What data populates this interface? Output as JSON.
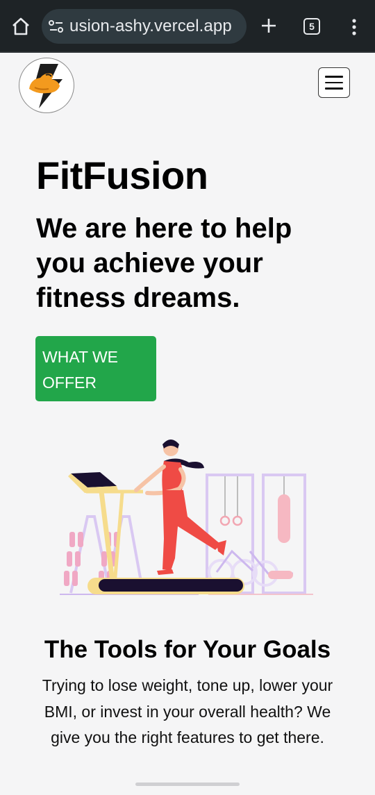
{
  "browser": {
    "url": "usion-ashy.vercel.app",
    "tab_count": "5",
    "icons": [
      "home-icon",
      "site-settings-icon",
      "new-tab-icon",
      "tabs-icon",
      "more-icon"
    ]
  },
  "header": {
    "logo_icon": "fitfusion-logo",
    "menu_icon": "hamburger-menu-icon"
  },
  "hero": {
    "brand": "FitFusion",
    "tagline": "We are here to help you achieve your fitness dreams.",
    "cta_label": "WHAT WE OFFER",
    "cta_color": "#22a64a",
    "illustration": "woman-on-treadmill-gym-illustration"
  },
  "tools": {
    "title": "The Tools for Your Goals",
    "description": "Trying to lose weight, tone up, lower your BMI, or invest in your overall health? We give you the right features to get there."
  }
}
